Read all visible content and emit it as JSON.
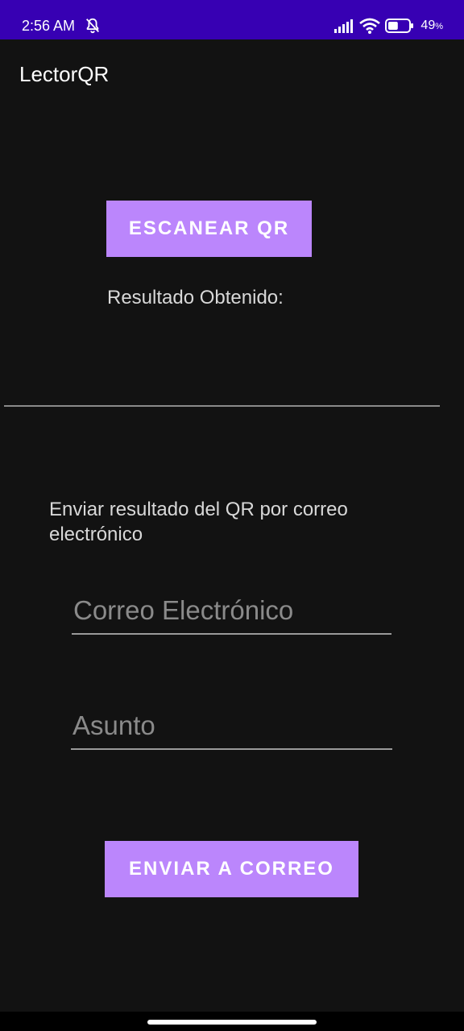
{
  "status_bar": {
    "time": "2:56 AM",
    "battery_percent": "49",
    "battery_unit": "%",
    "battery_level": 0.49,
    "icons": [
      "bell-off-icon",
      "signal-icon",
      "wifi-icon",
      "battery-icon"
    ]
  },
  "app_bar": {
    "title": "LectorQR"
  },
  "scan": {
    "button_label": "ESCANEAR QR",
    "result_label": "Resultado Obtenido:"
  },
  "email": {
    "caption": "Enviar resultado del QR por correo electrónico",
    "email_placeholder": "Correo Electrónico",
    "email_value": "",
    "subject_placeholder": "Asunto",
    "subject_value": "",
    "send_button_label": "ENVIAR A CORREO"
  },
  "colors": {
    "status_bar": "#3700B3",
    "background": "#121212",
    "button": "#BB86FC"
  }
}
